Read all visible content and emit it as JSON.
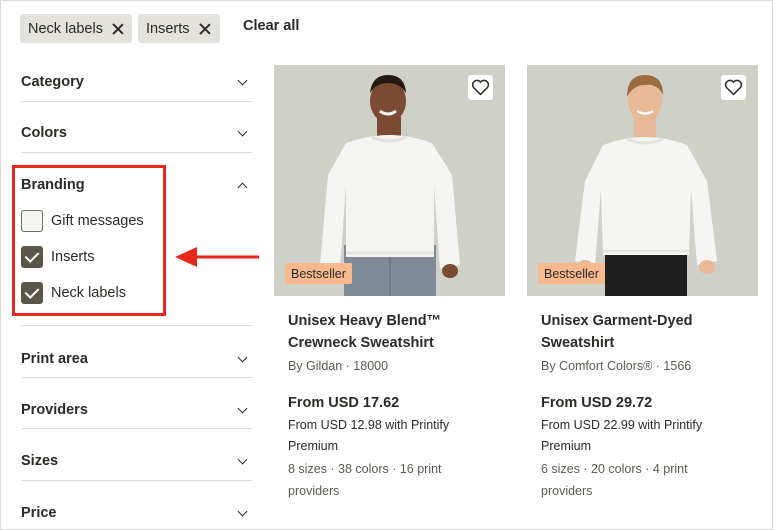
{
  "active_filters": {
    "chips": [
      {
        "label": "Neck labels"
      },
      {
        "label": "Inserts"
      }
    ],
    "clear_all_label": "Clear all"
  },
  "sidebar": {
    "sections": [
      {
        "title": "Category",
        "expanded": false
      },
      {
        "title": "Colors",
        "expanded": false
      },
      {
        "title": "Branding",
        "expanded": true
      },
      {
        "title": "Print area",
        "expanded": false
      },
      {
        "title": "Providers",
        "expanded": false
      },
      {
        "title": "Sizes",
        "expanded": false
      },
      {
        "title": "Price",
        "expanded": false
      }
    ],
    "branding_options": [
      {
        "label": "Gift messages",
        "checked": false
      },
      {
        "label": "Inserts",
        "checked": true
      },
      {
        "label": "Neck labels",
        "checked": true
      }
    ]
  },
  "annotation": {
    "highlight_color": "#e8271d"
  },
  "products": [
    {
      "badge": "Bestseller",
      "title": "Unisex Heavy Blend™ Crewneck Sweatshirt",
      "brand": "By Gildan · 18000",
      "price": "From USD 17.62",
      "premium": "From USD 12.98 with Printify Premium",
      "meta": "8 sizes · 38 colors · 16 print providers"
    },
    {
      "badge": "Bestseller",
      "title": "Unisex Garment-Dyed Sweatshirt",
      "brand": "By Comfort Colors® · 1566",
      "price": "From USD 29.72",
      "premium": "From USD 22.99 with Printify Premium",
      "meta": "6 sizes · 20 colors · 4 print providers"
    }
  ],
  "colors": {
    "badge_bg": "#f7b98d",
    "chip_bg": "#e3e2dc",
    "checkbox_checked": "#5a5648",
    "photo_bg": "#cfd0c7"
  }
}
